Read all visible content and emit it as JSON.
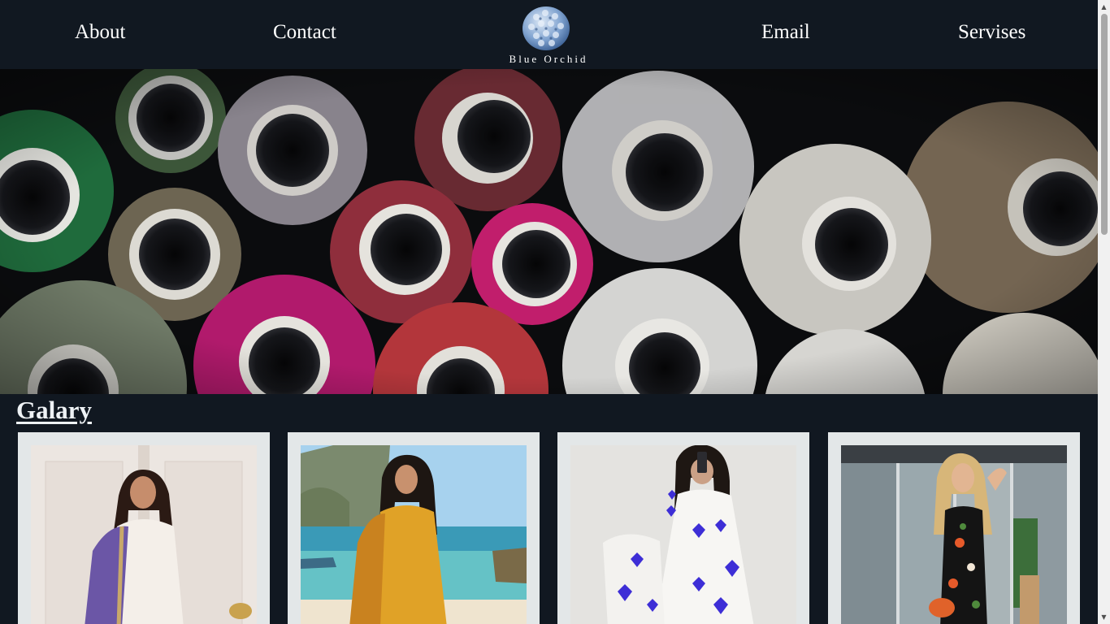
{
  "nav": {
    "about": "About",
    "contact": "Contact",
    "email": "Email",
    "services": "Servises"
  },
  "logo": {
    "text": "Blue Orchid",
    "icon": "blue-orchid-flower-icon"
  },
  "hero": {
    "image": "thread-spools-photo"
  },
  "gallery": {
    "title": "Galary",
    "items": [
      {
        "image": "woman-white-kurta-purple-dupatta-photo"
      },
      {
        "image": "woman-yellow-dress-beach-photo"
      },
      {
        "image": "woman-white-dress-purple-hearts-photo"
      },
      {
        "image": "woman-black-floral-jumpsuit-photo"
      }
    ]
  },
  "colors": {
    "background": "#111821",
    "nav_text": "#ffffff",
    "card_frame": "#e3e7e8"
  }
}
